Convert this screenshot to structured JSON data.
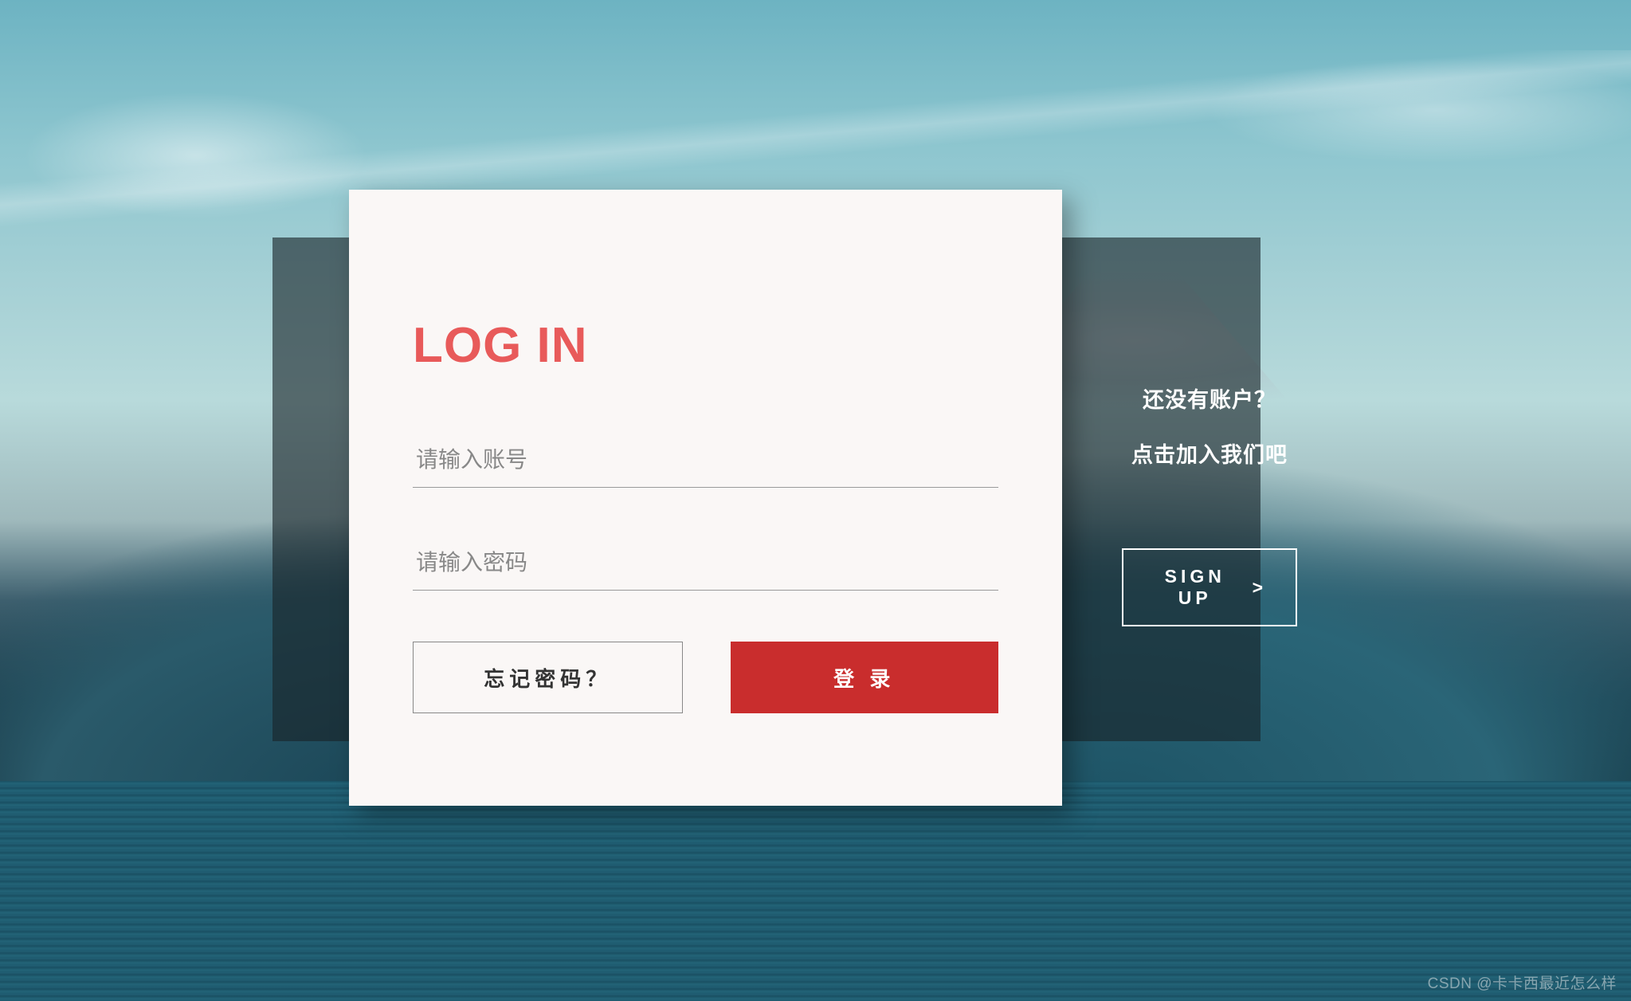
{
  "login": {
    "title": "LOG IN",
    "username_placeholder": "请输入账号",
    "password_placeholder": "请输入密码",
    "forgot_label": "忘记密码？",
    "submit_label": "登 录"
  },
  "signup": {
    "line1": "还没有账户？",
    "line2": "点击加入我们吧",
    "button_label": "SIGN UP",
    "arrow": ">"
  },
  "watermark": "CSDN @卡卡西最近怎么样",
  "colors": {
    "accent": "#e85a5a",
    "primary_button": "#c92d2d"
  }
}
